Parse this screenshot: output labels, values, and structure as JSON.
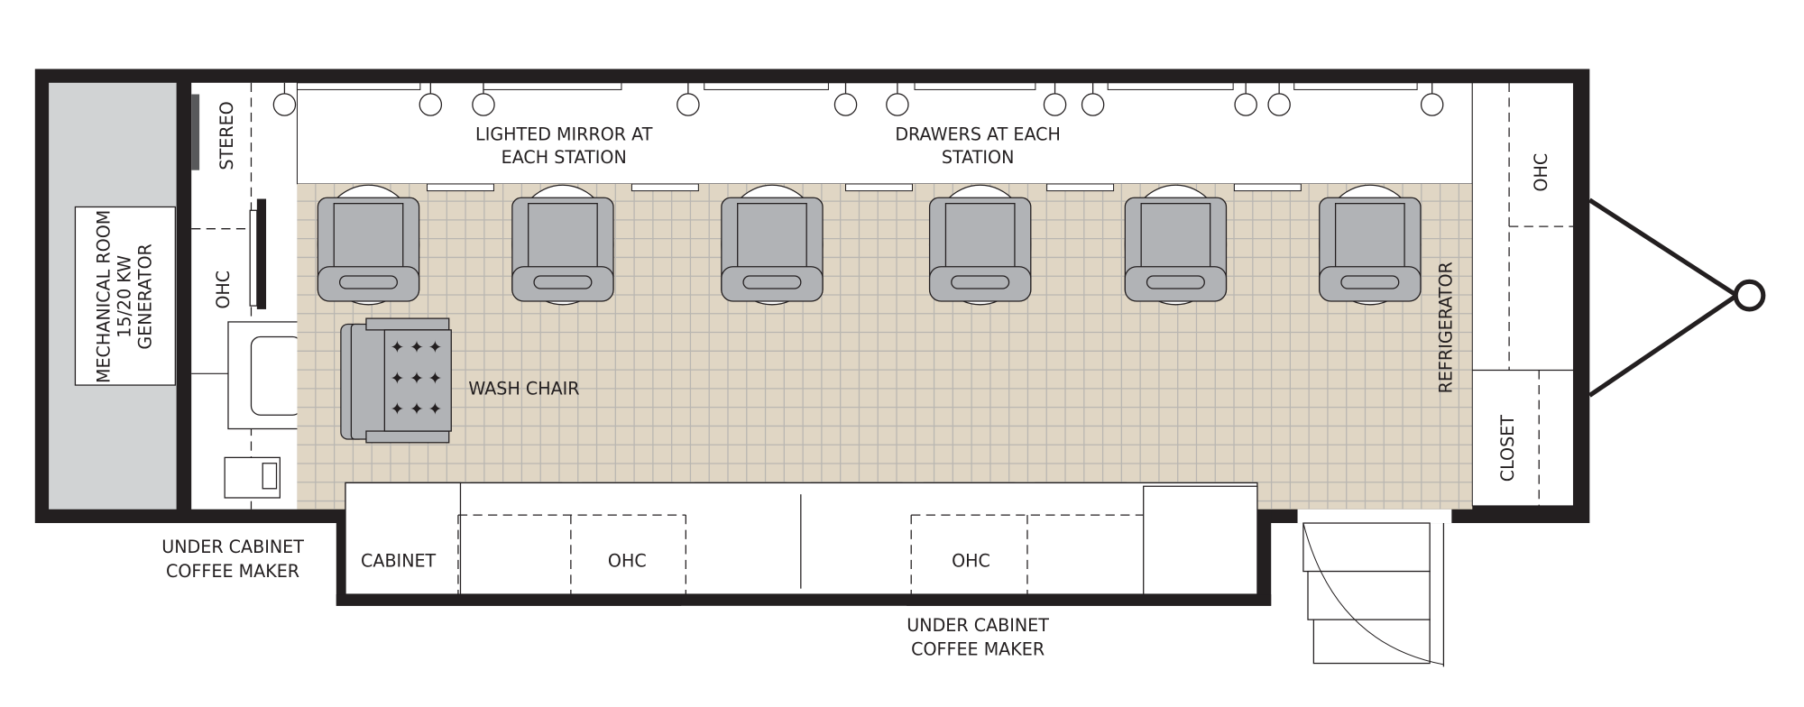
{
  "labels": {
    "mechanical_room": [
      "MECHANICAL ROOM",
      "15/20 KW",
      "GENERATOR"
    ],
    "stereo": "STEREO",
    "ohc_left": "OHC",
    "lighted_mirror": [
      "LIGHTED MIRROR AT",
      "EACH STATION"
    ],
    "drawers": [
      "DRAWERS AT EACH",
      "STATION"
    ],
    "wash_chair": "WASH CHAIR",
    "refrigerator": "REFRIGERATOR",
    "ohc_right": "OHC",
    "closet": "CLOSET",
    "cabinet": "CABINET",
    "ohc_bottom_left": "OHC",
    "ohc_bottom_right": "OHC",
    "coffee_maker_left": [
      "UNDER CABINET",
      "COFFEE MAKER"
    ],
    "coffee_maker_bottom": [
      "UNDER CABINET",
      "COFFEE MAKER"
    ]
  },
  "colors": {
    "wall": "#231f20",
    "floor_tile": "#e0d6c4",
    "mechanical_room": "#d1d3d4",
    "chair": "#b1b3b6"
  }
}
